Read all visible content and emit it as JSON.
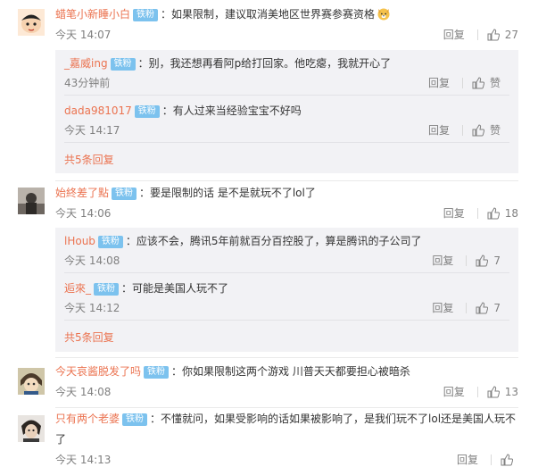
{
  "comments": [
    {
      "user": "蜡笔小新睡小白",
      "badge": "铁粉",
      "text": "：如果限制，建议取消美地区世界赛参赛资格",
      "time": "今天 14:07",
      "reply_label": "回复",
      "likes": "27",
      "replies": [
        {
          "user": "_嘉威ing",
          "badge": "铁粉",
          "text": "：别，我还想再看阿p给打回家。他吃瘪，我就开心了",
          "time": "43分钟前",
          "reply_label": "回复",
          "likes": "赞"
        },
        {
          "user": "dada981017",
          "badge": "铁粉",
          "text": "：有人过来当经验宝宝不好吗",
          "time": "今天 14:17",
          "reply_label": "回复",
          "likes": "赞"
        }
      ],
      "more_label": "共5条回复"
    },
    {
      "user": "始終差了點",
      "badge": "铁粉",
      "text": "：要是限制的话 是不是就玩不了lol了",
      "time": "今天 14:06",
      "reply_label": "回复",
      "likes": "18",
      "replies": [
        {
          "user": "lHoub",
          "badge": "铁粉",
          "text": "：应该不会，腾讯5年前就百分百控股了，算是腾讯的子公司了",
          "time": "今天 14:08",
          "reply_label": "回复",
          "likes": "7"
        },
        {
          "user": "逅來_",
          "badge": "铁粉",
          "text": "：可能是美国人玩不了",
          "time": "今天 14:12",
          "reply_label": "回复",
          "likes": "7"
        }
      ],
      "more_label": "共5条回复"
    },
    {
      "user": "今天哀酱脱发了吗",
      "badge": "铁粉",
      "text": "：你如果限制这两个游戏 川普天天都要担心被暗杀",
      "time": "今天 14:08",
      "reply_label": "回复",
      "likes": "13"
    },
    {
      "user": "只有两个老婆",
      "badge": "铁粉",
      "text": "：不懂就问，如果受影响的话如果被影响了，是我们玩不了lol还是美国人玩不",
      "text2": "了",
      "time": "今天 14:13",
      "reply_label": "回复",
      "likes": ""
    }
  ]
}
